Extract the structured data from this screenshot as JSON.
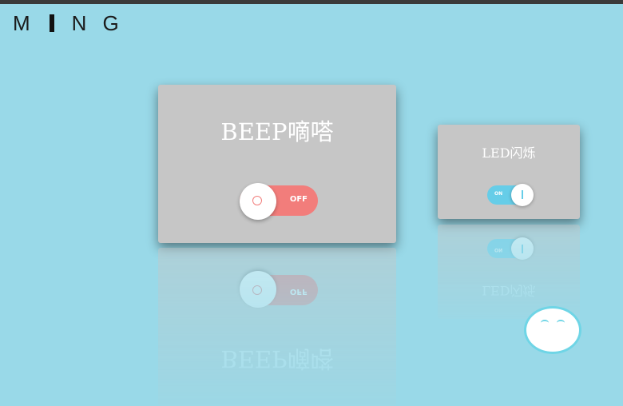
{
  "brand": {
    "logo_text": "MING"
  },
  "cards": {
    "beep": {
      "title": "BEEP嘀嗒",
      "toggle_label": "OFF",
      "toggle_state": "off"
    },
    "led": {
      "title": "LED闪烁",
      "toggle_label": "ON",
      "toggle_state": "on"
    }
  },
  "colors": {
    "background": "#99d9e8",
    "card": "#c6c6c6",
    "toggle_off": "#f27d7b",
    "toggle_on": "#66cde8"
  },
  "icons": {
    "chat": "chat-bubble-icon"
  }
}
